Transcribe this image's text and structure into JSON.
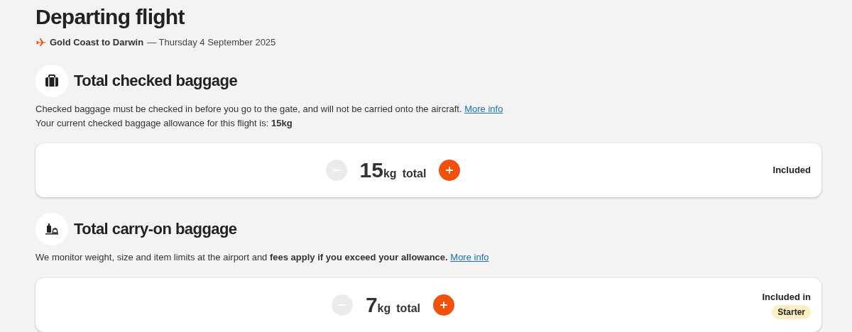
{
  "header": {
    "title": "Departing flight",
    "route": "Gold Coast to Darwin",
    "date": "— Thursday 4 September 2025"
  },
  "sections": [
    {
      "kind": "checked",
      "title": "Total checked baggage",
      "lines": [
        "Checked baggage must be checked in before you go to the gate, and will not be carried onto the aircraft.",
        "Your current checked baggage allowance for this flight is: **15kg**"
      ],
      "link": "More info",
      "stepper": {
        "value": "15",
        "unit": "kg",
        "label": "total",
        "minus_disabled": true,
        "plus_disabled": false
      },
      "status": "Included"
    },
    {
      "kind": "carry_on",
      "title": "Total carry-on baggage",
      "lines": [
        "We monitor weight, size and item limits at the airport and **fees apply if you exceed your allowance.**"
      ],
      "link": "More info",
      "stepper": {
        "value": "7",
        "unit": "kg",
        "label": "total",
        "minus_disabled": true,
        "plus_disabled": false
      },
      "status": "Included in",
      "badge": "Starter"
    }
  ]
}
